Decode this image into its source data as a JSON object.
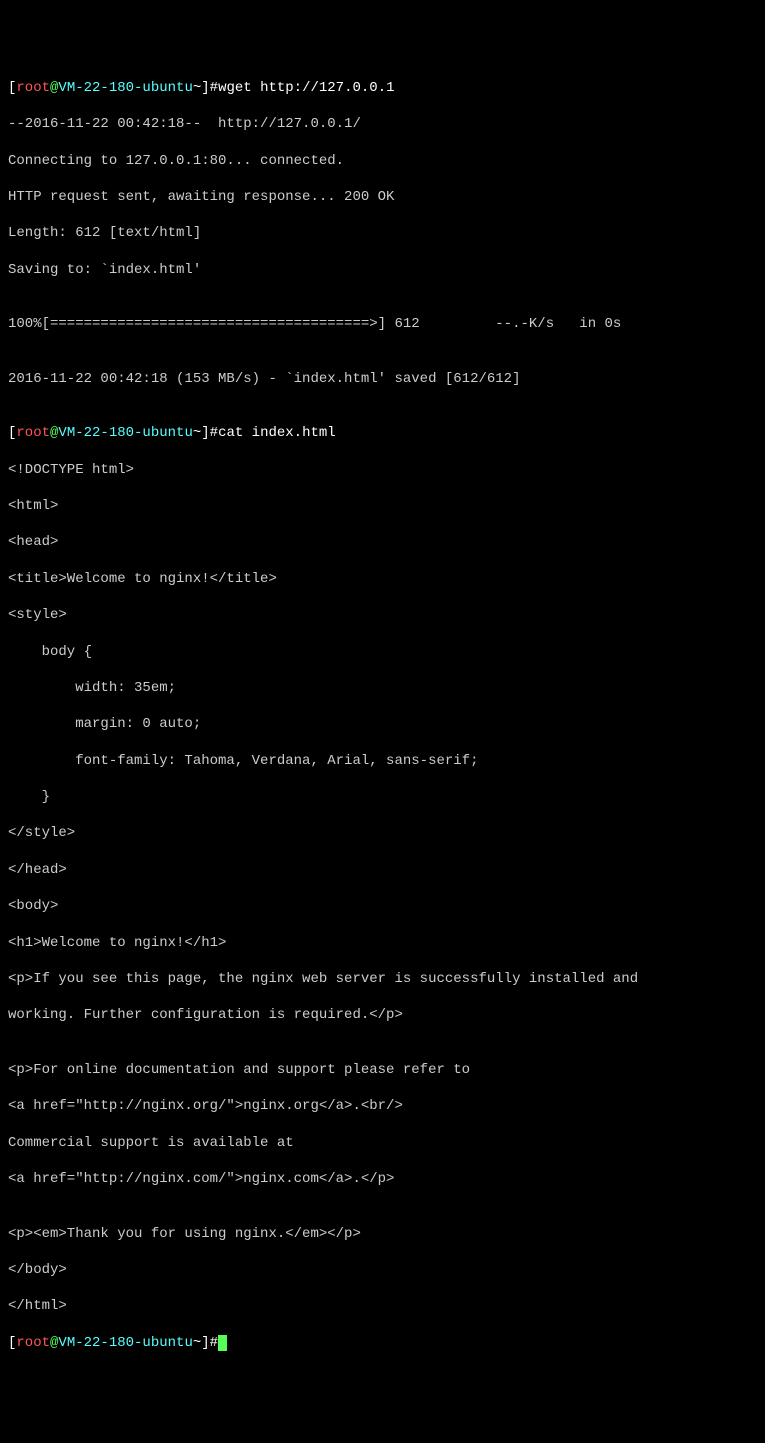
{
  "prompt1": {
    "bracket_open": "[",
    "user": "root",
    "at": "@",
    "host": "VM-22-180-ubuntu",
    "tilde": "~",
    "bracket_close": "]",
    "hash": "#",
    "command": "wget http://127.0.0.1"
  },
  "wget_out": {
    "l1": "--2016-11-22 00:42:18--  http://127.0.0.1/",
    "l2": "Connecting to 127.0.0.1:80... connected.",
    "l3": "HTTP request sent, awaiting response... 200 OK",
    "l4": "Length: 612 [text/html]",
    "l5": "Saving to: `index.html'",
    "l6": "",
    "l7": "100%[======================================>] 612         --.-K/s   in 0s",
    "l8": "",
    "l9": "2016-11-22 00:42:18 (153 MB/s) - `index.html' saved [612/612]",
    "l10": ""
  },
  "prompt2": {
    "bracket_open": "[",
    "user": "root",
    "at": "@",
    "host": "VM-22-180-ubuntu",
    "tilde": "~",
    "bracket_close": "]",
    "hash": "#",
    "command": "cat index.html"
  },
  "cat_out": {
    "l1": "<!DOCTYPE html>",
    "l2": "<html>",
    "l3": "<head>",
    "l4": "<title>Welcome to nginx!</title>",
    "l5": "<style>",
    "l6": "    body {",
    "l7": "        width: 35em;",
    "l8": "        margin: 0 auto;",
    "l9": "        font-family: Tahoma, Verdana, Arial, sans-serif;",
    "l10": "    }",
    "l11": "</style>",
    "l12": "</head>",
    "l13": "<body>",
    "l14": "<h1>Welcome to nginx!</h1>",
    "l15": "<p>If you see this page, the nginx web server is successfully installed and",
    "l16": "working. Further configuration is required.</p>",
    "l17": "",
    "l18": "<p>For online documentation and support please refer to",
    "l19": "<a href=\"http://nginx.org/\">nginx.org</a>.<br/>",
    "l20": "Commercial support is available at",
    "l21": "<a href=\"http://nginx.com/\">nginx.com</a>.</p>",
    "l22": "",
    "l23": "<p><em>Thank you for using nginx.</em></p>",
    "l24": "</body>",
    "l25": "</html>"
  },
  "prompt3": {
    "bracket_open": "[",
    "user": "root",
    "at": "@",
    "host": "VM-22-180-ubuntu",
    "tilde": "~",
    "bracket_close": "]",
    "hash": "#"
  }
}
